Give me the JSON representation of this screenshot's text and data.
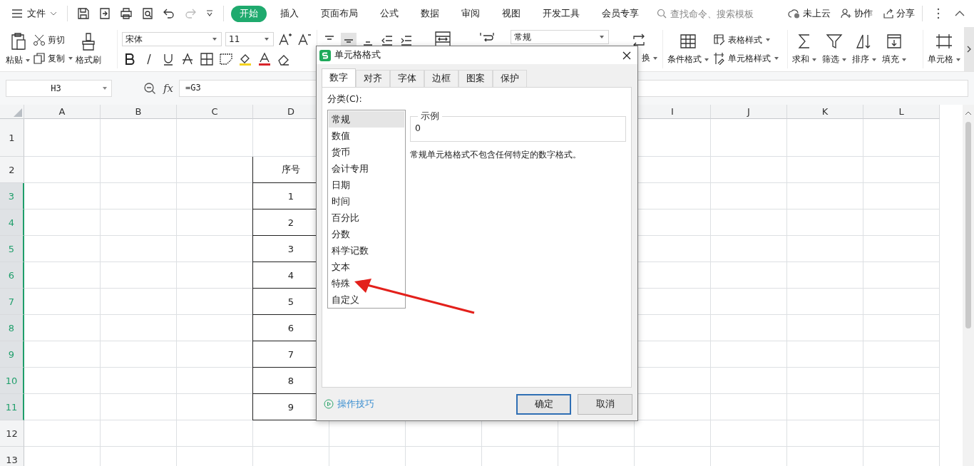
{
  "menu_bar": {
    "file": "文件",
    "redo": {
      "disabled": true
    },
    "tabs": [
      {
        "label": "开始",
        "selected": true
      },
      {
        "label": "插入",
        "selected": false
      },
      {
        "label": "页面布局",
        "selected": false
      },
      {
        "label": "公式",
        "selected": false
      },
      {
        "label": "数据",
        "selected": false
      },
      {
        "label": "审阅",
        "selected": false
      },
      {
        "label": "视图",
        "selected": false
      },
      {
        "label": "开发工具",
        "selected": false
      },
      {
        "label": "会员专享",
        "selected": false
      }
    ],
    "search": {
      "placeholder": "查找命令、搜索模板"
    },
    "cloud": "未上云",
    "collaborate": "协作",
    "share": "分享"
  },
  "ribbon": {
    "paste": "粘贴",
    "cut": "剪切",
    "copy": "复制",
    "format_painter": "格式刷",
    "font": "宋体",
    "font_size": "11",
    "number_format": "常规",
    "convert": "换",
    "conditional_format": "条件格式",
    "table_style": "表格样式",
    "cell_style": "单元格样式",
    "sum": "求和",
    "filter": "筛选",
    "sort": "排序",
    "fill": "填充",
    "cells": "单元格"
  },
  "formula_bar": {
    "cell_ref": "H3",
    "function_label": "fx",
    "formula": "=G3"
  },
  "sheet": {
    "columns_left": [
      "A",
      "B",
      "C",
      "D"
    ],
    "columns_right": [
      "I",
      "J",
      "K",
      "L"
    ],
    "rows": [
      {
        "label": "1",
        "selected": false
      },
      {
        "label": "2",
        "selected": false,
        "d": "序号"
      },
      {
        "label": "3",
        "selected": true,
        "d": "1"
      },
      {
        "label": "4",
        "selected": true,
        "d": "2"
      },
      {
        "label": "5",
        "selected": true,
        "d": "3"
      },
      {
        "label": "6",
        "selected": true,
        "d": "4"
      },
      {
        "label": "7",
        "selected": true,
        "d": "5"
      },
      {
        "label": "8",
        "selected": true,
        "d": "6"
      },
      {
        "label": "9",
        "selected": true,
        "d": "7"
      },
      {
        "label": "10",
        "selected": true,
        "d": "8"
      },
      {
        "label": "11",
        "selected": true,
        "d": "9"
      },
      {
        "label": "12",
        "selected": false
      },
      {
        "label": "13",
        "selected": false
      }
    ]
  },
  "dialog": {
    "title": "单元格格式",
    "tabs": [
      {
        "label": "数字",
        "selected": true
      },
      {
        "label": "对齐",
        "selected": false
      },
      {
        "label": "字体",
        "selected": false
      },
      {
        "label": "边框",
        "selected": false
      },
      {
        "label": "图案",
        "selected": false
      },
      {
        "label": "保护",
        "selected": false
      }
    ],
    "category_label": "分类(C):",
    "categories": [
      {
        "label": "常规",
        "selected": true
      },
      {
        "label": "数值",
        "selected": false
      },
      {
        "label": "货币",
        "selected": false
      },
      {
        "label": "会计专用",
        "selected": false
      },
      {
        "label": "日期",
        "selected": false
      },
      {
        "label": "时间",
        "selected": false
      },
      {
        "label": "百分比",
        "selected": false
      },
      {
        "label": "分数",
        "selected": false
      },
      {
        "label": "科学记数",
        "selected": false
      },
      {
        "label": "文本",
        "selected": false
      },
      {
        "label": "特殊",
        "selected": false
      },
      {
        "label": "自定义",
        "selected": false
      }
    ],
    "sample_label": "示例",
    "sample_value": "0",
    "description": "常规单元格格式不包含任何特定的数字格式。",
    "tips_link": "操作技巧",
    "buttons": [
      {
        "label": "确定",
        "default": true
      },
      {
        "label": "取消",
        "default": false
      }
    ]
  }
}
